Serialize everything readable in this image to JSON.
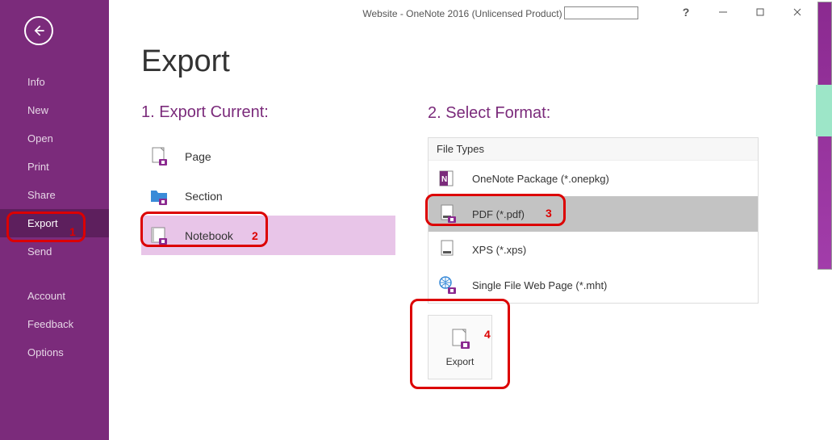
{
  "titlebar": {
    "title": "Website  -  OneNote 2016 (Unlicensed Product)",
    "help": "?"
  },
  "sidebar": {
    "items": [
      {
        "label": "Info"
      },
      {
        "label": "New"
      },
      {
        "label": "Open"
      },
      {
        "label": "Print"
      },
      {
        "label": "Share"
      },
      {
        "label": "Export"
      },
      {
        "label": "Send"
      }
    ],
    "bottom": [
      {
        "label": "Account"
      },
      {
        "label": "Feedback"
      },
      {
        "label": "Options"
      }
    ]
  },
  "page": {
    "heading": "Export",
    "step1": "1. Export Current:",
    "step2": "2. Select Format:",
    "file_types_header": "File Types",
    "export_items": [
      {
        "label": "Page"
      },
      {
        "label": "Section"
      },
      {
        "label": "Notebook"
      }
    ],
    "format_items": [
      {
        "label": "OneNote Package (*.onepkg)"
      },
      {
        "label": "PDF (*.pdf)"
      },
      {
        "label": "XPS (*.xps)"
      },
      {
        "label": "Single File Web Page (*.mht)"
      }
    ],
    "export_button": "Export"
  },
  "annotations": {
    "n1": "1",
    "n2": "2",
    "n3": "3",
    "n4": "4"
  }
}
